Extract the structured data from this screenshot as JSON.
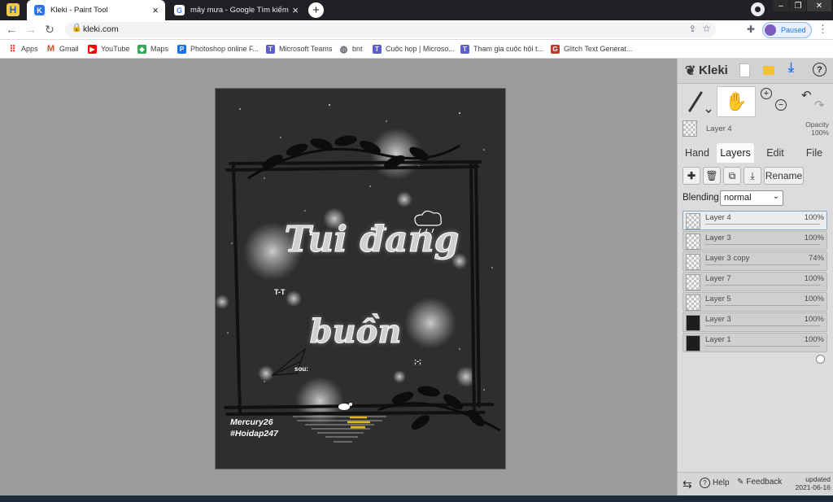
{
  "browser": {
    "tabs": [
      {
        "title": "Kleki - Paint Tool",
        "active": true,
        "favicon": "kleki-icon"
      },
      {
        "title": "mây mưa - Google Tìm kiếm",
        "active": false,
        "favicon": "google-icon"
      }
    ],
    "new_tab_symbol": "+",
    "url": "kleki.com",
    "profile_status": "Paused",
    "window_controls": {
      "minimize": "–",
      "restore": "❐",
      "close": "✕"
    }
  },
  "bookmarks": [
    {
      "label": "Apps",
      "icon": "apps-grid-icon",
      "color": "#ea4335"
    },
    {
      "label": "Gmail",
      "icon": "gmail-icon",
      "color": "#ea4335"
    },
    {
      "label": "YouTube",
      "icon": "youtube-icon",
      "color": "#ff0000"
    },
    {
      "label": "Maps",
      "icon": "maps-icon",
      "color": "#34a853"
    },
    {
      "label": "Photoshop online F...",
      "icon": "photoshop-icon",
      "color": "#1b73e8"
    },
    {
      "label": "Microsoft Teams",
      "icon": "teams-icon",
      "color": "#5b5fc7"
    },
    {
      "label": "bnt",
      "icon": "globe-icon",
      "color": "#5f6368"
    },
    {
      "label": "Cuộc họp | Microso...",
      "icon": "teams-icon",
      "color": "#5b5fc7"
    },
    {
      "label": "Tham gia cuộc hội t...",
      "icon": "teams-icon",
      "color": "#5b5fc7"
    },
    {
      "label": "Glitch Text Generat...",
      "icon": "glitch-icon",
      "color": "#c0392b"
    }
  ],
  "artwork": {
    "title_line1": "Tui đang",
    "title_line2": "buồn",
    "face_left": "T-T",
    "face_right": ";-;",
    "side_text": "sou:",
    "credit_line1": "Mercury26",
    "credit_line2": "#Hoidap247"
  },
  "panel": {
    "logo": "Kleki",
    "current_layer": "Layer 4",
    "opacity_label": "Opacity",
    "opacity_value": "100%",
    "tabs": [
      "Hand",
      "Layers",
      "Edit",
      "File"
    ],
    "active_tab": "Layers",
    "rename_label": "Rename",
    "blending_label": "Blending",
    "blending_value": "normal",
    "layers": [
      {
        "name": "Layer 4",
        "opacity": "100%",
        "opacity_frac": 1.0,
        "selected": true,
        "thumb": "transparent"
      },
      {
        "name": "Layer 3",
        "opacity": "100%",
        "opacity_frac": 1.0,
        "selected": false,
        "thumb": "transparent"
      },
      {
        "name": "Layer 3 copy",
        "opacity": "74%",
        "opacity_frac": 0.74,
        "selected": false,
        "thumb": "transparent"
      },
      {
        "name": "Layer 7",
        "opacity": "100%",
        "opacity_frac": 1.0,
        "selected": false,
        "thumb": "transparent"
      },
      {
        "name": "Layer 5",
        "opacity": "100%",
        "opacity_frac": 1.0,
        "selected": false,
        "thumb": "transparent"
      },
      {
        "name": "Layer 3",
        "opacity": "100%",
        "opacity_frac": 1.0,
        "selected": false,
        "thumb": "dark"
      },
      {
        "name": "Layer 1",
        "opacity": "100%",
        "opacity_frac": 1.0,
        "selected": false,
        "thumb": "dark"
      }
    ],
    "footer": {
      "help": "Help",
      "feedback": "Feedback",
      "updated_line1": "updated",
      "updated_line2": "2021-06-16"
    }
  },
  "colors": {
    "accent": "#2b73e8",
    "tab_bar": "#202124",
    "panel": "#dcdcdc",
    "canvas": "#2e2e2e"
  }
}
